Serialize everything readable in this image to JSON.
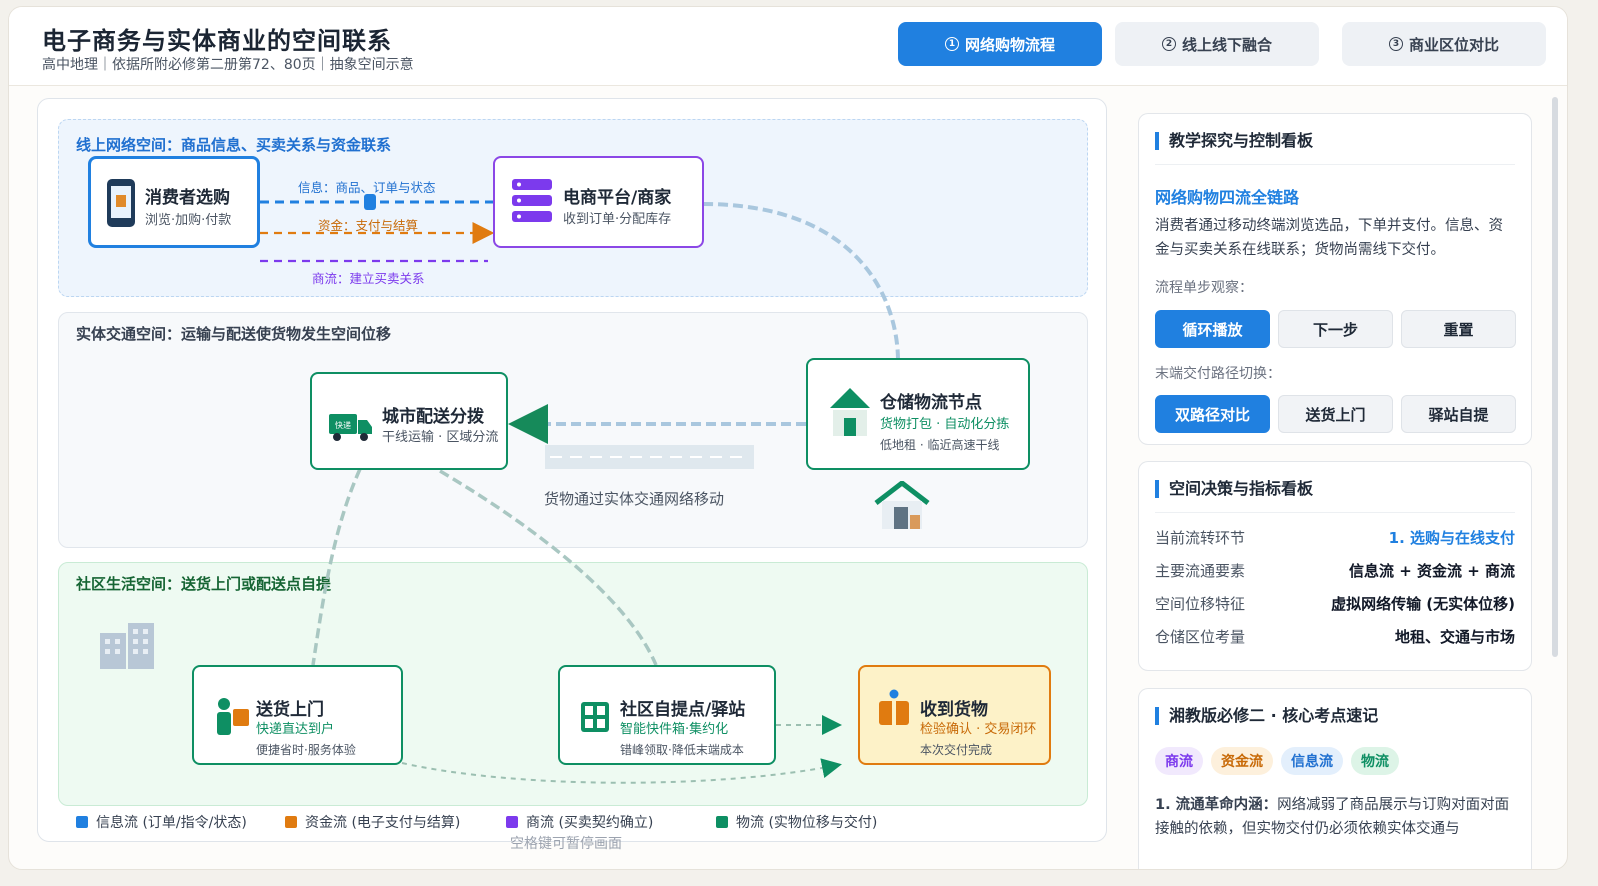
{
  "header": {
    "title": "电子商务与实体商业的空间联系",
    "subtitle": "高中地理｜依据所附必修第二册第72、80页｜抽象空间示意",
    "tabs": [
      {
        "num": "1",
        "label": "网络购物流程",
        "active": true
      },
      {
        "num": "2",
        "label": "线上线下融合",
        "active": false
      },
      {
        "num": "3",
        "label": "商业区位对比",
        "active": false
      }
    ]
  },
  "diagram": {
    "zones": {
      "online": "线上网络空间：商品信息、买卖关系与资金联系",
      "physical": "实体交通空间：运输与配送使货物发生空间位移",
      "community": "社区生活空间：送货上门或配送点自提"
    },
    "nodes": {
      "consumer": {
        "title": "消费者选购",
        "sub": "浏览·加购·付款"
      },
      "platform": {
        "title": "电商平台/商家",
        "sub": "收到订单·分配库存"
      },
      "warehouse": {
        "title": "仓储物流节点",
        "sub": "货物打包 · 自动化分拣",
        "note": "低地租 · 临近高速干线"
      },
      "city": {
        "title": "城市配送分拨",
        "sub": "干线运输 · 区域分流"
      },
      "home": {
        "title": "送货上门",
        "sub": "快递直达到户",
        "note": "便捷省时·服务体验"
      },
      "station": {
        "title": "社区自提点/驿站",
        "sub": "智能快件箱·集约化",
        "note": "错峰领取·降低末端成本"
      },
      "receive": {
        "title": "收到货物",
        "sub": "检验确认 · 交易闭环",
        "note": "本次交付完成"
      }
    },
    "flows": {
      "info": "信息：商品、订单与状态",
      "money": "资金：支付与结算",
      "trade": "商流：建立买卖关系",
      "transport": "货物通过实体交通网络移动"
    },
    "truck_text": "快递",
    "legend": [
      {
        "label": "信息流 (订单/指令/状态)",
        "color": "#2080e0"
      },
      {
        "label": "资金流 (电子支付与结算)",
        "color": "#e07b10"
      },
      {
        "label": "商流 (买卖契约确立)",
        "color": "#7c3aed"
      },
      {
        "label": "物流 (实物位移与交付)",
        "color": "#0e8f63"
      }
    ],
    "hint": "空格键可暂停画面"
  },
  "panel1": {
    "title": "教学探究与控制看板",
    "heading": "网络购物四流全链路",
    "desc": "消费者通过移动终端浏览选品，下单并支付。信息、资金与买卖关系在线联系；货物尚需线下交付。",
    "step_label": "流程单步观察：",
    "step_buttons": [
      "循环播放",
      "下一步",
      "重置"
    ],
    "path_label": "末端交付路径切换：",
    "path_buttons": [
      "双路径对比",
      "送货上门",
      "驿站自提"
    ]
  },
  "panel2": {
    "title": "空间决策与指标看板",
    "rows": [
      {
        "k": "当前流转环节",
        "v": "1. 选购与在线支付"
      },
      {
        "k": "主要流通要素",
        "v": "信息流 + 资金流 + 商流"
      },
      {
        "k": "空间位移特征",
        "v": "虚拟网络传输 (无实体位移)"
      },
      {
        "k": "仓储区位考量",
        "v": "地租、交通与市场"
      }
    ]
  },
  "panel3": {
    "title": "湘教版必修二 · 核心考点速记",
    "chips": [
      "商流",
      "资金流",
      "信息流",
      "物流"
    ],
    "point_title": "1. 流通革命内涵：",
    "point_text": "网络减弱了商品展示与订购对面对面接触的依赖，但实物交付仍必须依赖实体交通与"
  },
  "colors": {
    "accent": "#2080e0",
    "info": "#2080e0",
    "money": "#e07b10",
    "trade": "#7c3aed",
    "logistics": "#0e8f63"
  }
}
